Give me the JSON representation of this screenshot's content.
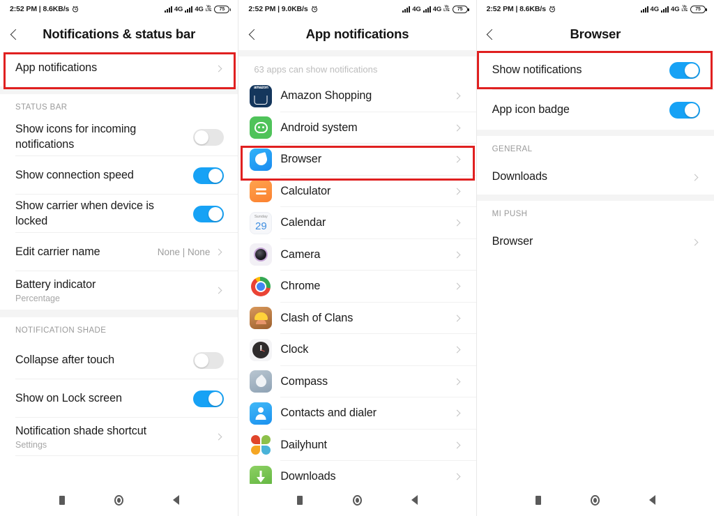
{
  "status_bar": {
    "time_left_p1": "2:52 PM | 8.6KB/s",
    "time_left_p2": "2:52 PM | 9.0KB/s",
    "time_left_p3": "2:52 PM | 8.6KB/s",
    "network_1": "4G",
    "network_2": "4G",
    "volte_top": "Vo",
    "volte_bottom": "LTE",
    "battery": "75",
    "alarm_icon": "alarm-clock-icon"
  },
  "panel1": {
    "title": "Notifications & status bar",
    "back_icon": "back-chevron-icon",
    "highlighted_row": {
      "label": "App notifications",
      "chevron": "chevron-right-icon"
    },
    "sections": [
      {
        "heading": "STATUS BAR",
        "rows": [
          {
            "label": "Show icons for incoming notifications",
            "control": "toggle",
            "state": "off"
          },
          {
            "label": "Show connection speed",
            "control": "toggle",
            "state": "on"
          },
          {
            "label": "Show carrier when device is locked",
            "control": "toggle",
            "state": "on"
          },
          {
            "label": "Edit carrier name",
            "control": "value",
            "value": "None | None"
          },
          {
            "label": "Battery indicator",
            "sub": "Percentage",
            "control": "chevron"
          }
        ]
      },
      {
        "heading": "NOTIFICATION SHADE",
        "rows": [
          {
            "label": "Collapse after touch",
            "control": "toggle",
            "state": "off"
          },
          {
            "label": "Show on Lock screen",
            "control": "toggle",
            "state": "on"
          },
          {
            "label": "Notification shade shortcut",
            "sub": "Settings",
            "control": "chevron"
          }
        ]
      }
    ]
  },
  "panel2": {
    "title": "App notifications",
    "back_icon": "back-chevron-icon",
    "apps_note": "63 apps can show notifications",
    "apps": [
      {
        "name": "Amazon Shopping",
        "icon": "amazon-shopping-icon"
      },
      {
        "name": "Android system",
        "icon": "android-system-icon"
      },
      {
        "name": "Browser",
        "icon": "browser-icon",
        "highlighted": true
      },
      {
        "name": "Calculator",
        "icon": "calculator-icon"
      },
      {
        "name": "Calendar",
        "icon": "calendar-icon"
      },
      {
        "name": "Camera",
        "icon": "camera-icon"
      },
      {
        "name": "Chrome",
        "icon": "chrome-icon"
      },
      {
        "name": "Clash of Clans",
        "icon": "clash-of-clans-icon"
      },
      {
        "name": "Clock",
        "icon": "clock-icon"
      },
      {
        "name": "Compass",
        "icon": "compass-icon"
      },
      {
        "name": "Contacts and dialer",
        "icon": "contacts-dialer-icon"
      },
      {
        "name": "Dailyhunt",
        "icon": "dailyhunt-icon"
      },
      {
        "name": "Downloads",
        "icon": "downloads-icon"
      }
    ],
    "calendar_icon_day": "Sunday",
    "calendar_icon_date": "29",
    "amazon_icon_word": "amazon"
  },
  "panel3": {
    "title": "Browser",
    "back_icon": "back-chevron-icon",
    "rows_top": [
      {
        "label": "Show notifications",
        "control": "toggle",
        "state": "on",
        "highlighted": true
      },
      {
        "label": "App icon badge",
        "control": "toggle",
        "state": "on"
      }
    ],
    "sections": [
      {
        "heading": "GENERAL",
        "rows": [
          {
            "label": "Downloads",
            "control": "chevron"
          }
        ]
      },
      {
        "heading": "MI PUSH",
        "rows": [
          {
            "label": "Browser",
            "control": "chevron"
          }
        ]
      }
    ]
  },
  "nav_bar": {
    "recents": "recents-square-icon",
    "home": "home-circle-icon",
    "back": "back-triangle-icon"
  },
  "colors": {
    "toggle_on": "#17a2f5",
    "toggle_off": "#e6e6e6",
    "highlight_box": "#e02020",
    "section_bg": "#f4f4f4"
  }
}
